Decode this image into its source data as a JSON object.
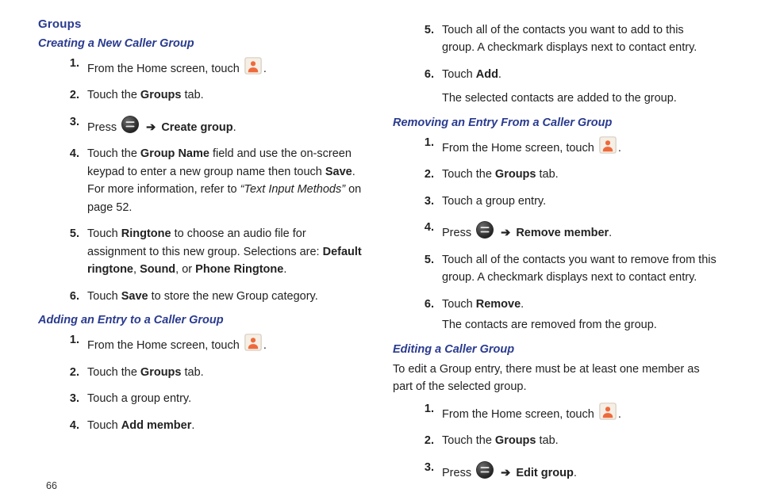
{
  "page_number": "66",
  "section": {
    "title": "Groups"
  },
  "icons": {
    "contacts_label": "contacts-icon",
    "menu_label": "menu-icon"
  },
  "strings": {
    "arrow": "➔",
    "period": "."
  },
  "creating": {
    "title": "Creating a New Caller Group",
    "steps": [
      {
        "n": "1.",
        "pre": "From the Home screen, touch "
      },
      {
        "n": "2.",
        "pre": "Touch the ",
        "b1": "Groups",
        "post": " tab."
      },
      {
        "n": "3.",
        "pre": "Press ",
        "b_after_icon": "Create group",
        "post": "."
      },
      {
        "n": "4.",
        "seg1": "Touch the ",
        "b1": "Group Name",
        "seg2": " field and use the on-screen keypad to enter a new group name then touch ",
        "b2": "Save",
        "seg3": ". For more information, refer to ",
        "ref": "“Text Input Methods”",
        "seg4": "  on page 52."
      },
      {
        "n": "5.",
        "seg1": "Touch ",
        "b1": "Ringtone",
        "seg2": " to choose an audio file for assignment to this new group. Selections are: ",
        "b2": "Default ringtone",
        "seg3": ", ",
        "b3": "Sound",
        "seg4": ", or ",
        "b4": "Phone Ringtone",
        "seg5": "."
      },
      {
        "n": "6.",
        "seg1": "Touch ",
        "b1": "Save",
        "seg2": " to store the new Group category."
      }
    ]
  },
  "adding": {
    "title": "Adding an Entry to a Caller Group",
    "steps": [
      {
        "n": "1.",
        "pre": "From the Home screen, touch "
      },
      {
        "n": "2.",
        "pre": "Touch the ",
        "b1": "Groups",
        "post": " tab."
      },
      {
        "n": "3.",
        "pre": "Touch a group entry."
      },
      {
        "n": "4.",
        "pre": "Touch ",
        "b1": "Add member",
        "post": "."
      }
    ]
  },
  "adding_cont": {
    "steps": [
      {
        "n": "5.",
        "seg1": "Touch all of the contacts you want to add to this group. A checkmark displays next to contact entry."
      },
      {
        "n": "6.",
        "seg1": "Touch ",
        "b1": "Add",
        "seg2": ".",
        "after": "The selected contacts are added to the group."
      }
    ]
  },
  "removing": {
    "title": "Removing an Entry From a Caller Group",
    "steps": [
      {
        "n": "1.",
        "pre": "From the Home screen, touch "
      },
      {
        "n": "2.",
        "pre": "Touch the ",
        "b1": "Groups",
        "post": " tab."
      },
      {
        "n": "3.",
        "pre": "Touch a group entry."
      },
      {
        "n": "4.",
        "pre": "Press ",
        "b_after_icon": "Remove member",
        "post": "."
      },
      {
        "n": "5.",
        "seg1": "Touch all of the contacts you want to remove from this group. A checkmark displays next to contact entry."
      },
      {
        "n": "6.",
        "seg1": "Touch ",
        "b1": "Remove",
        "seg2": ".",
        "after": "The contacts are removed from the group."
      }
    ]
  },
  "editing": {
    "title": "Editing a Caller Group",
    "intro": "To edit a Group entry, there must be at least one member as part of the selected group.",
    "steps": [
      {
        "n": "1.",
        "pre": "From the Home screen, touch "
      },
      {
        "n": "2.",
        "pre": "Touch the ",
        "b1": "Groups",
        "post": " tab."
      },
      {
        "n": "3.",
        "pre": "Press ",
        "b_after_icon": "Edit group",
        "post": "."
      }
    ]
  }
}
